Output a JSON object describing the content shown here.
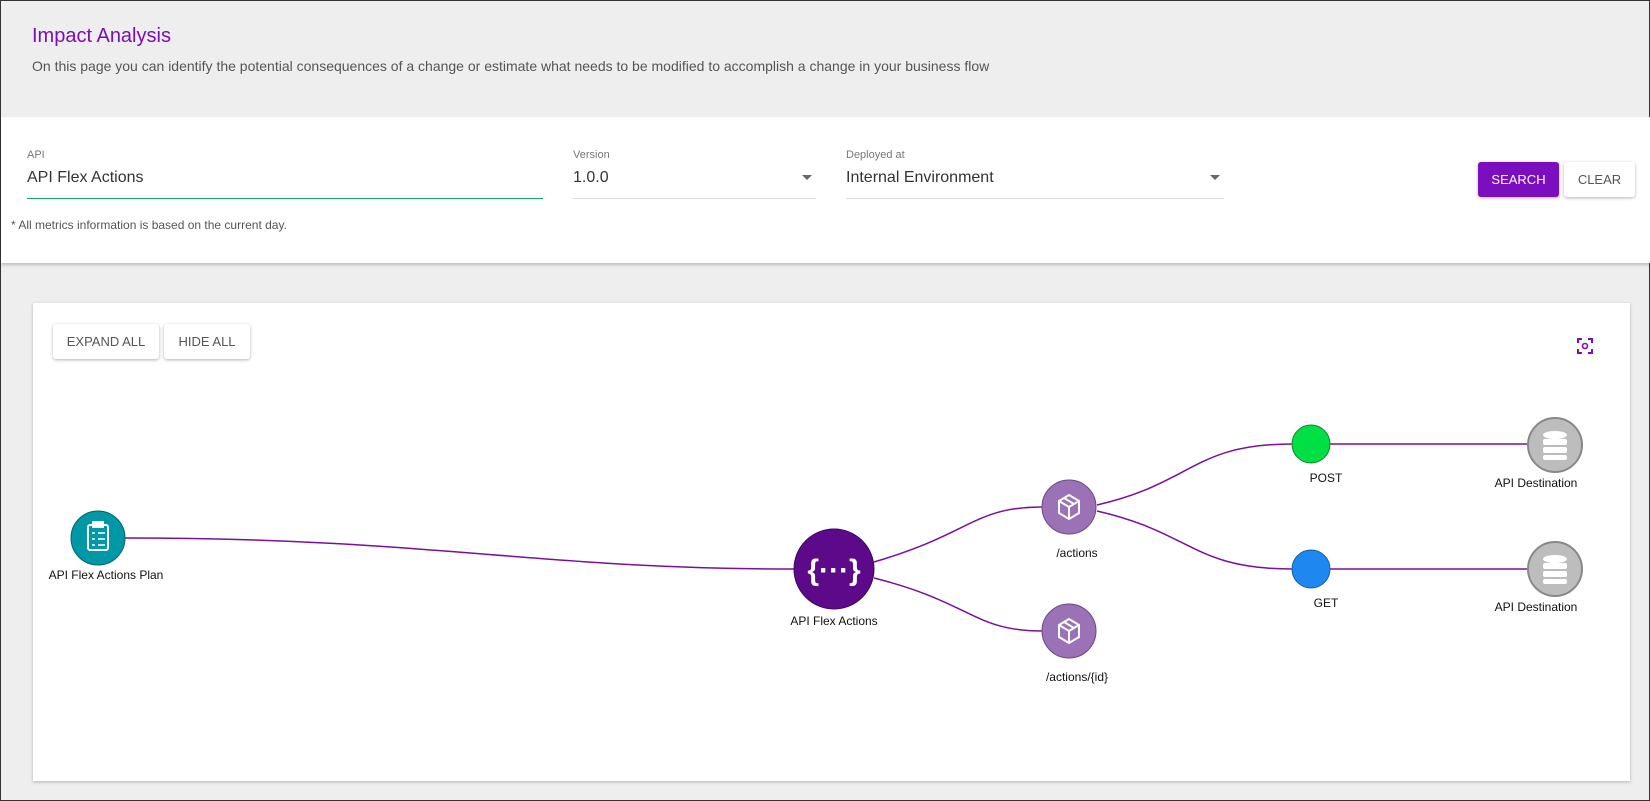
{
  "header": {
    "title": "Impact Analysis",
    "subtitle": "On this page you can identify the potential consequences of a change or estimate what needs to be modified to accomplish a change in your business flow"
  },
  "filters": {
    "api_label": "API",
    "api_value": "API Flex Actions",
    "version_label": "Version",
    "version_value": "1.0.0",
    "deployed_label": "Deployed at",
    "deployed_value": "Internal Environment",
    "search_label": "SEARCH",
    "clear_label": "CLEAR",
    "note": "* All metrics information is based on the current day."
  },
  "graph": {
    "expand_all_label": "EXPAND ALL",
    "hide_all_label": "HIDE ALL",
    "focus_icon": "focus-icon",
    "colors": {
      "edge": "#7b0f9b",
      "plan": "#0097a7",
      "api": "#5c0a8a",
      "resource": "#9b72b5",
      "post": "#00e045",
      "get": "#1e88f0",
      "destination": "#bdbdbd"
    },
    "nodes": {
      "plan": "API Flex Actions Plan",
      "api": "API Flex Actions",
      "actions": "/actions",
      "actions_id": "/actions/{id}",
      "post": "POST",
      "get": "GET",
      "dest1": "API Destination",
      "dest2": "API Destination"
    }
  }
}
